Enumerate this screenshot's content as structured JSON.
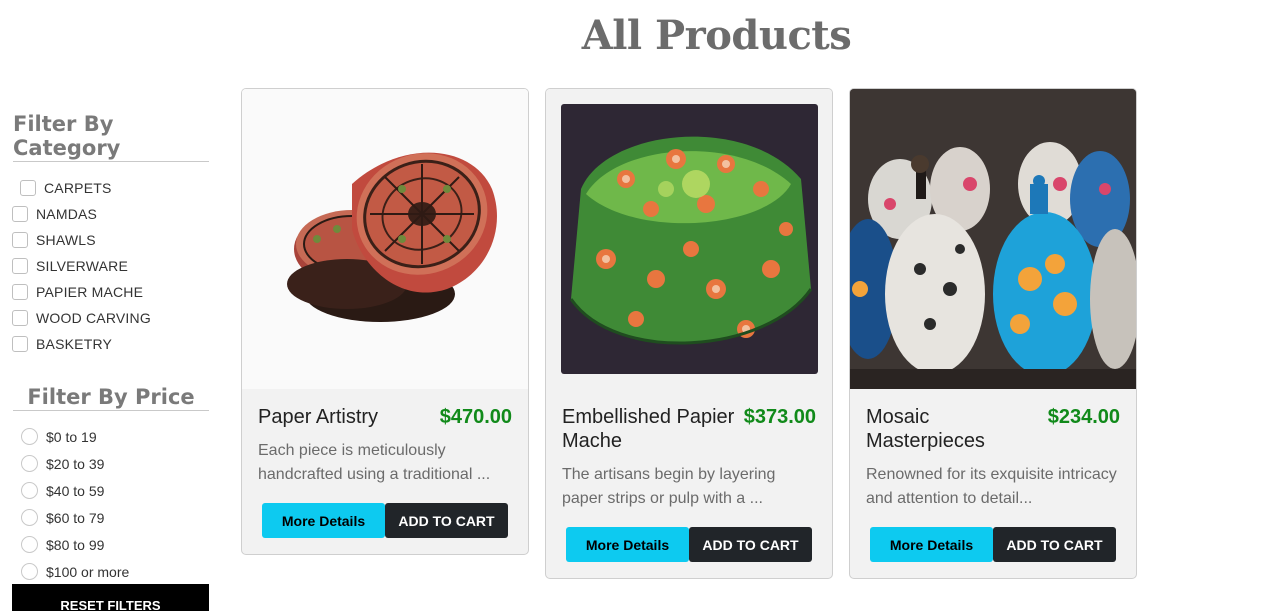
{
  "page": {
    "title": "All Products"
  },
  "filters": {
    "category_heading": "Filter By Category",
    "categories": [
      "CARPETS",
      "NAMDAS",
      "SHAWLS",
      "SILVERWARE",
      "PAPIER MACHE",
      "WOOD CARVING",
      "BASKETRY"
    ],
    "price_heading": "Filter By Price",
    "prices": [
      "$0 to 19",
      "$20 to 39",
      "$40 to 59",
      "$60 to 79",
      "$80 to 99",
      "$100 or more"
    ],
    "reset_label": "RESET FILTERS"
  },
  "products": [
    {
      "name": "Paper Artistry",
      "price": "$470.00",
      "description": "Each piece is meticulously handcrafted using a traditional ...",
      "details_label": "More Details",
      "cart_label": "ADD TO CART"
    },
    {
      "name": "Embellished Papier Mache",
      "price": "$373.00",
      "description": "The artisans begin by layering paper strips or pulp with a ...",
      "details_label": "More Details",
      "cart_label": "ADD TO CART"
    },
    {
      "name": "Mosaic Masterpieces",
      "price": "$234.00",
      "description": "Renowned for its exquisite intricacy and attention to detail...",
      "details_label": "More Details",
      "cart_label": "ADD TO CART"
    }
  ],
  "colors": {
    "price": "#118a1a",
    "details_button": "#0dcaf0",
    "cart_button": "#212529",
    "reset_button": "#000000"
  }
}
